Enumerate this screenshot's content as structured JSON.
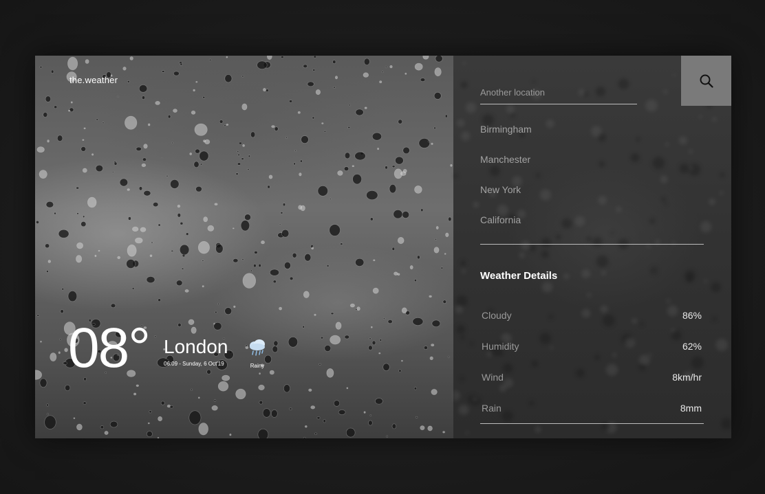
{
  "brand": "the.weather",
  "current": {
    "temperature": "08°",
    "city": "London",
    "datetime": "06:09 - Sunday, 6 Oct'19",
    "condition": "Rainy",
    "condition_icon": "rain-cloud-icon"
  },
  "search": {
    "placeholder": "Another location",
    "icon": "search-icon"
  },
  "locations": [
    "Birmingham",
    "Manchester",
    "New York",
    "California"
  ],
  "details": {
    "title": "Weather Details",
    "rows": [
      {
        "label": "Cloudy",
        "value": "86%"
      },
      {
        "label": "Humidity",
        "value": "62%"
      },
      {
        "label": "Wind",
        "value": "8km/hr"
      },
      {
        "label": "Rain",
        "value": "8mm"
      }
    ]
  },
  "colors": {
    "page_background": "#1b1b1b",
    "search_button": "#7a7a7a",
    "text_primary": "#ffffff",
    "text_muted": "#9a9a9a"
  }
}
